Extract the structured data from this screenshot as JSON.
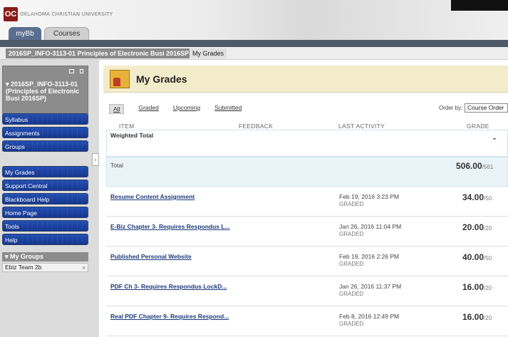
{
  "header": {
    "logo_mark": "OC",
    "logo_text": "OKLAHOMA CHRISTIAN UNIVERSITY",
    "tabs": [
      {
        "label": "myBb"
      },
      {
        "label": "Courses"
      }
    ]
  },
  "breadcrumb": {
    "course": "2016SP_INFO-3113-01 Principles of Electronic Busi 2016SP",
    "current": "My Grades"
  },
  "sidebar": {
    "course_title": "2016SP_INFO-3113-01 (Principles of Electronic Busi 2016SP)",
    "items": [
      {
        "label": "Syllabus"
      },
      {
        "label": "Assignments"
      },
      {
        "label": "Groups"
      },
      {
        "label": "My Grades"
      },
      {
        "label": "Support Central"
      },
      {
        "label": "Blackboard Help"
      },
      {
        "label": "Home Page"
      },
      {
        "label": "Tools"
      },
      {
        "label": "Help"
      }
    ],
    "groups_header": "My Groups",
    "group_item": "Ebiz Team 2b"
  },
  "main": {
    "title": "My Grades",
    "filters": [
      "All",
      "Graded",
      "Upcoming",
      "Submitted"
    ],
    "order_by_label": "Order by:",
    "order_by_value": "Course Order",
    "columns": {
      "item": "ITEM",
      "feedback": "FEEDBACK",
      "last_activity": "LAST ACTIVITY",
      "grade": "GRADE"
    },
    "weighted_total": {
      "label": "Weighted Total",
      "score": "-"
    },
    "total": {
      "label": "Total",
      "score": "506.00",
      "possible": "/561"
    },
    "rows": [
      {
        "name": "Resume Content Assignment",
        "date": "Feb 19, 2016 3:23 PM",
        "status": "GRADED",
        "score": "34.00",
        "possible": "/50"
      },
      {
        "name": "E-Biz Chapter 3- Requires Respondus L...",
        "date": "Jan 26, 2016 11:04 PM",
        "status": "GRADED",
        "score": "20.00",
        "possible": "/20"
      },
      {
        "name": "Published Personal Website",
        "date": "Feb 19, 2016 2:26 PM",
        "status": "GRADED",
        "score": "40.00",
        "possible": "/50"
      },
      {
        "name": "PDF Ch 3- Requires Respondus LockD...",
        "date": "Jan 26, 2016 11:37 PM",
        "status": "GRADED",
        "score": "16.00",
        "possible": "/20"
      },
      {
        "name": "Real PDF Chapter 9- Requires Respond...",
        "date": "Feb 8, 2016 12:49 PM",
        "status": "GRADED",
        "score": "16.00",
        "possible": "/20"
      }
    ]
  }
}
